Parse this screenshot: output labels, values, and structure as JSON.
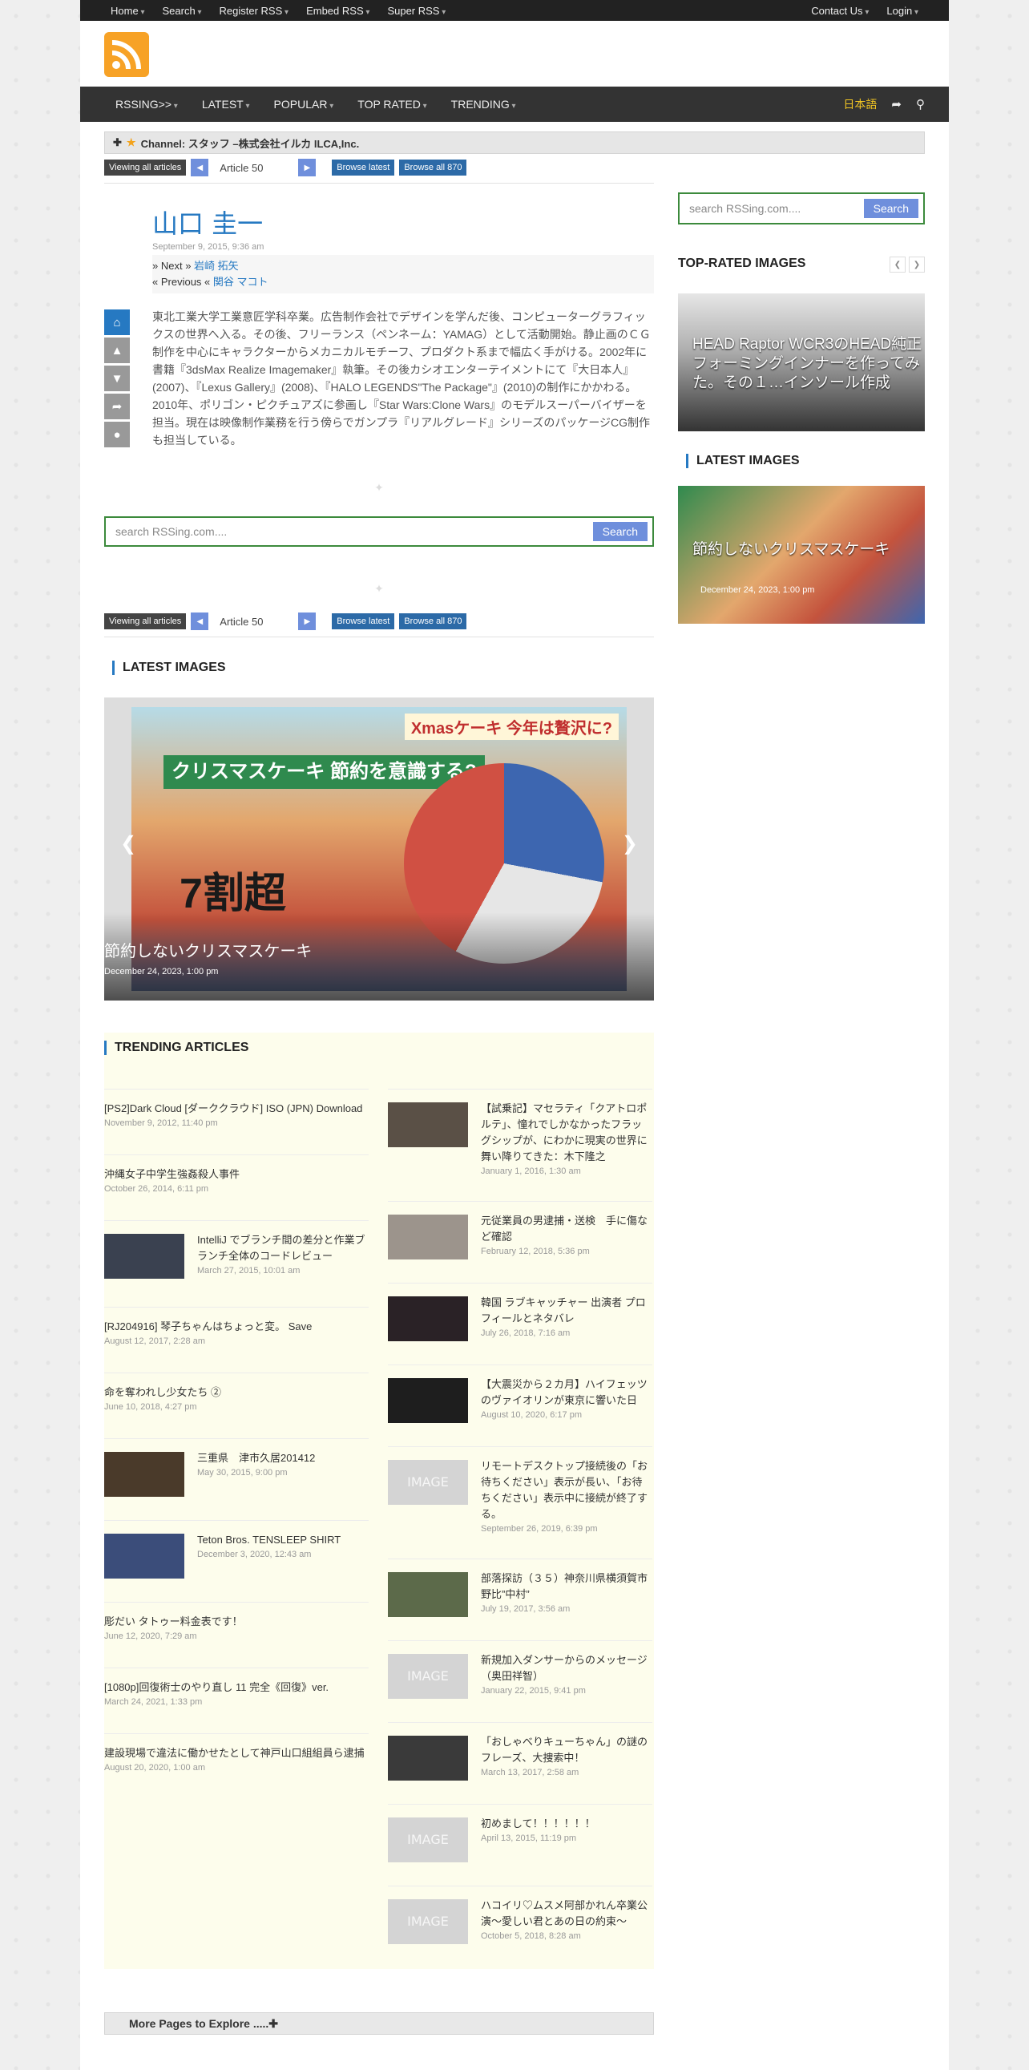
{
  "topbar": {
    "left": [
      "Home",
      "Search",
      "Register RSS",
      "Embed RSS",
      "Super RSS"
    ],
    "right": [
      "Contact Us",
      "Login"
    ]
  },
  "nav": {
    "items": [
      "RSSING>>",
      "LATEST",
      "POPULAR",
      "TOP RATED",
      "TRENDING"
    ],
    "lang": "日本語"
  },
  "channel": {
    "label": "Channel: スタッフ –株式会社イルカ ILCA,Inc."
  },
  "pager": {
    "viewing": "Viewing all articles",
    "select": "Article 50",
    "browse_latest": "Browse latest",
    "browse_all": "Browse all 870"
  },
  "article": {
    "title": "山口 圭一",
    "date": "September 9, 2015, 9:36 am",
    "next_label": "Next",
    "next_name": "岩崎 拓矢",
    "prev_label": "Previous",
    "prev_name": "関谷 マコト",
    "body": "東北工業大学工業意匠学科卒業。広告制作会社でデザインを学んだ後、コンピューターグラフィックスの世界へ入る。その後、フリーランス（ペンネーム：YAMAG）として活動開始。静止画のＣＧ制作を中心にキャラクターからメカニカルモチーフ、プロダクト系まで幅広く手がける。2002年に書籍『3dsMax Realize Imagemaker』執筆。その後カシオエンターテイメントにて『大日本人』(2007)、『Lexus Gallery』(2008)、『HALO LEGENDS\"The Package\"』(2010)の制作にかかわる。2010年、ポリゴン・ピクチュアズに参画し『Star Wars:Clone Wars』のモデルスーパーバイザーを担当。現在は映像制作業務を行う傍らでガンプラ『リアルグレード』シリーズのパッケージCG制作も担当している。"
  },
  "search": {
    "placeholder": "search RSSing.com....",
    "button": "Search"
  },
  "latest": {
    "title": "LATEST IMAGES",
    "caption": "節約しないクリスマスケーキ",
    "date": "December 24, 2023, 1:00 pm",
    "img_badge": "クリスマスケーキ 節約を意識する?",
    "img_big": "7割超",
    "img_xmas": "Xmasケーキ 今年は贅沢に?"
  },
  "trending": {
    "title": "TRENDING ARTICLES",
    "left": [
      {
        "title": "[PS2]Dark Cloud [ダーククラウド] ISO (JPN) Download",
        "date": "November 9, 2012, 11:40 pm"
      },
      {
        "title": "沖縄女子中学生強姦殺人事件",
        "date": "October 26, 2014, 6:11 pm"
      },
      {
        "title": "IntelliJ でブランチ間の差分と作業ブランチ全体のコードレビュー",
        "date": "March 27, 2015, 10:01 am"
      },
      {
        "title": "[RJ204916] 琴子ちゃんはちょっと変。 Save",
        "date": "August 12, 2017, 2:28 am"
      },
      {
        "title": "命を奪われし少女たち ②",
        "date": "June 10, 2018, 4:27 pm"
      },
      {
        "title": "三重県　津市久居201412",
        "date": "May 30, 2015, 9:00 pm"
      },
      {
        "title": "Teton Bros. TENSLEEP SHIRT",
        "date": "December 3, 2020, 12:43 am"
      },
      {
        "title": "彫だい タトゥー料金表です！",
        "date": "June 12, 2020, 7:29 am"
      },
      {
        "title": "[1080p]回復術士のやり直し 11 完全《回復》ver.",
        "date": "March 24, 2021, 1:33 pm"
      },
      {
        "title": "建設現場で違法に働かせたとして神戸山口組組員ら逮捕",
        "date": "August 20, 2020, 1:00 am"
      }
    ],
    "right": [
      {
        "title": "【試乗記】マセラティ「クアトロポルテ」、憧れでしかなかったフラッグシップが、にわかに現実の世界に舞い降りてきた：木下隆之",
        "date": "January 1, 2016, 1:30 am"
      },
      {
        "title": "元従業員の男逮捕・送検　手に傷など確認",
        "date": "February 12, 2018, 5:36 pm"
      },
      {
        "title": "韓国 ラブキャッチャー 出演者 プロフィールとネタバレ",
        "date": "July 26, 2018, 7:16 am"
      },
      {
        "title": "【大震災から２カ月】ハイフェッツのヴァイオリンが東京に響いた日",
        "date": "August 10, 2020, 6:17 pm"
      },
      {
        "title": "リモートデスクトップ接続後の「お待ちください」表示が長い、「お待ちください」表示中に接続が終了する。",
        "date": "September 26, 2019, 6:39 pm"
      },
      {
        "title": "部落探訪（３５）神奈川県横須賀市野比”中村”",
        "date": "July 19, 2017, 3:56 am"
      },
      {
        "title": "新規加入ダンサーからのメッセージ（奥田祥智）",
        "date": "January 22, 2015, 9:41 pm"
      },
      {
        "title": "「おしゃべりキューちゃん」の謎のフレーズ、大捜索中！",
        "date": "March 13, 2017, 2:58 am"
      },
      {
        "title": "初めまして！！！！！！",
        "date": "April 13, 2015, 11:19 pm"
      },
      {
        "title": "ハコイリ♡ムスメ阿部かれん卒業公演〜愛しい君とあの日の約束〜",
        "date": "October 5, 2018, 8:28 am"
      }
    ]
  },
  "sidebar": {
    "top_rated": "TOP-RATED IMAGES",
    "top_caption": "HEAD Raptor WCR3のHEAD純正フォーミングインナーを作ってみた。その１…インソール作成",
    "latest": "LATEST IMAGES",
    "latest_caption": "節約しないクリスマスケーキ",
    "latest_date": "December 24, 2023, 1:00 pm"
  },
  "na_label": "IMAGE",
  "more": "More Pages to Explore .....",
  "colors": {
    "accent": "#2679c2",
    "search_border": "#3c8a3c",
    "nav": "#333333",
    "rss": "#f7a226"
  }
}
